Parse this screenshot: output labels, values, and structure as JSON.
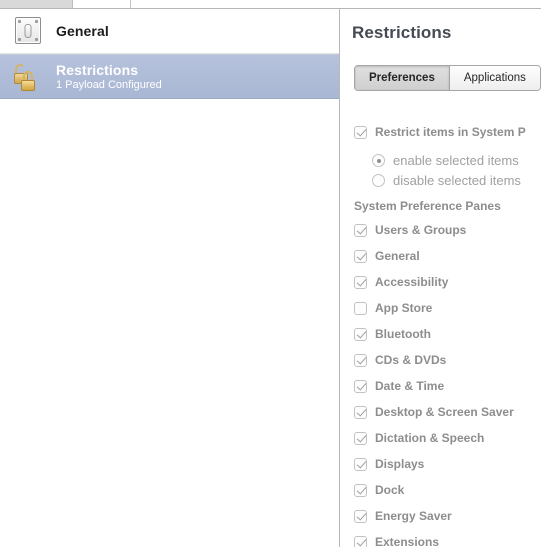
{
  "window": {
    "tabstrip": {
      "tabs": [
        {
          "name": "tab-1",
          "selected": true
        },
        {
          "name": "tab-2",
          "selected": false
        },
        {
          "name": "tab-3",
          "selected": false
        }
      ]
    }
  },
  "sidebar": {
    "payloads": [
      {
        "title": "General",
        "subtitle": "",
        "icon": "switch-plate-icon",
        "selected": false
      },
      {
        "title": "Restrictions",
        "subtitle": "1 Payload Configured",
        "icon": "padlocks-icon",
        "selected": true
      }
    ]
  },
  "detail": {
    "title": "Restrictions",
    "tabs": [
      {
        "label": "Preferences",
        "selected": true
      },
      {
        "label": "Applications",
        "selected": false
      }
    ],
    "restrict_checkbox": {
      "label": "Restrict items in System P",
      "checked": true
    },
    "mode_radios": [
      {
        "label": "enable selected items",
        "selected": true
      },
      {
        "label": "disable selected items",
        "selected": false
      }
    ],
    "panes_header": "System Preference Panes",
    "panes": [
      {
        "label": "Users & Groups",
        "checked": true
      },
      {
        "label": "General",
        "checked": true
      },
      {
        "label": "Accessibility",
        "checked": true
      },
      {
        "label": "App Store",
        "checked": false
      },
      {
        "label": "Bluetooth",
        "checked": true
      },
      {
        "label": "CDs & DVDs",
        "checked": true
      },
      {
        "label": "Date & Time",
        "checked": true
      },
      {
        "label": "Desktop & Screen Saver",
        "checked": true
      },
      {
        "label": "Dictation & Speech",
        "checked": true
      },
      {
        "label": "Displays",
        "checked": true
      },
      {
        "label": "Dock",
        "checked": true
      },
      {
        "label": "Energy Saver",
        "checked": true
      },
      {
        "label": "Extensions",
        "checked": true
      }
    ]
  },
  "colors": {
    "selection_blue": "#aebace",
    "title_slate": "#464a54",
    "label_gray": "#8d8d8d",
    "lock_gold": "#e3bc63"
  }
}
